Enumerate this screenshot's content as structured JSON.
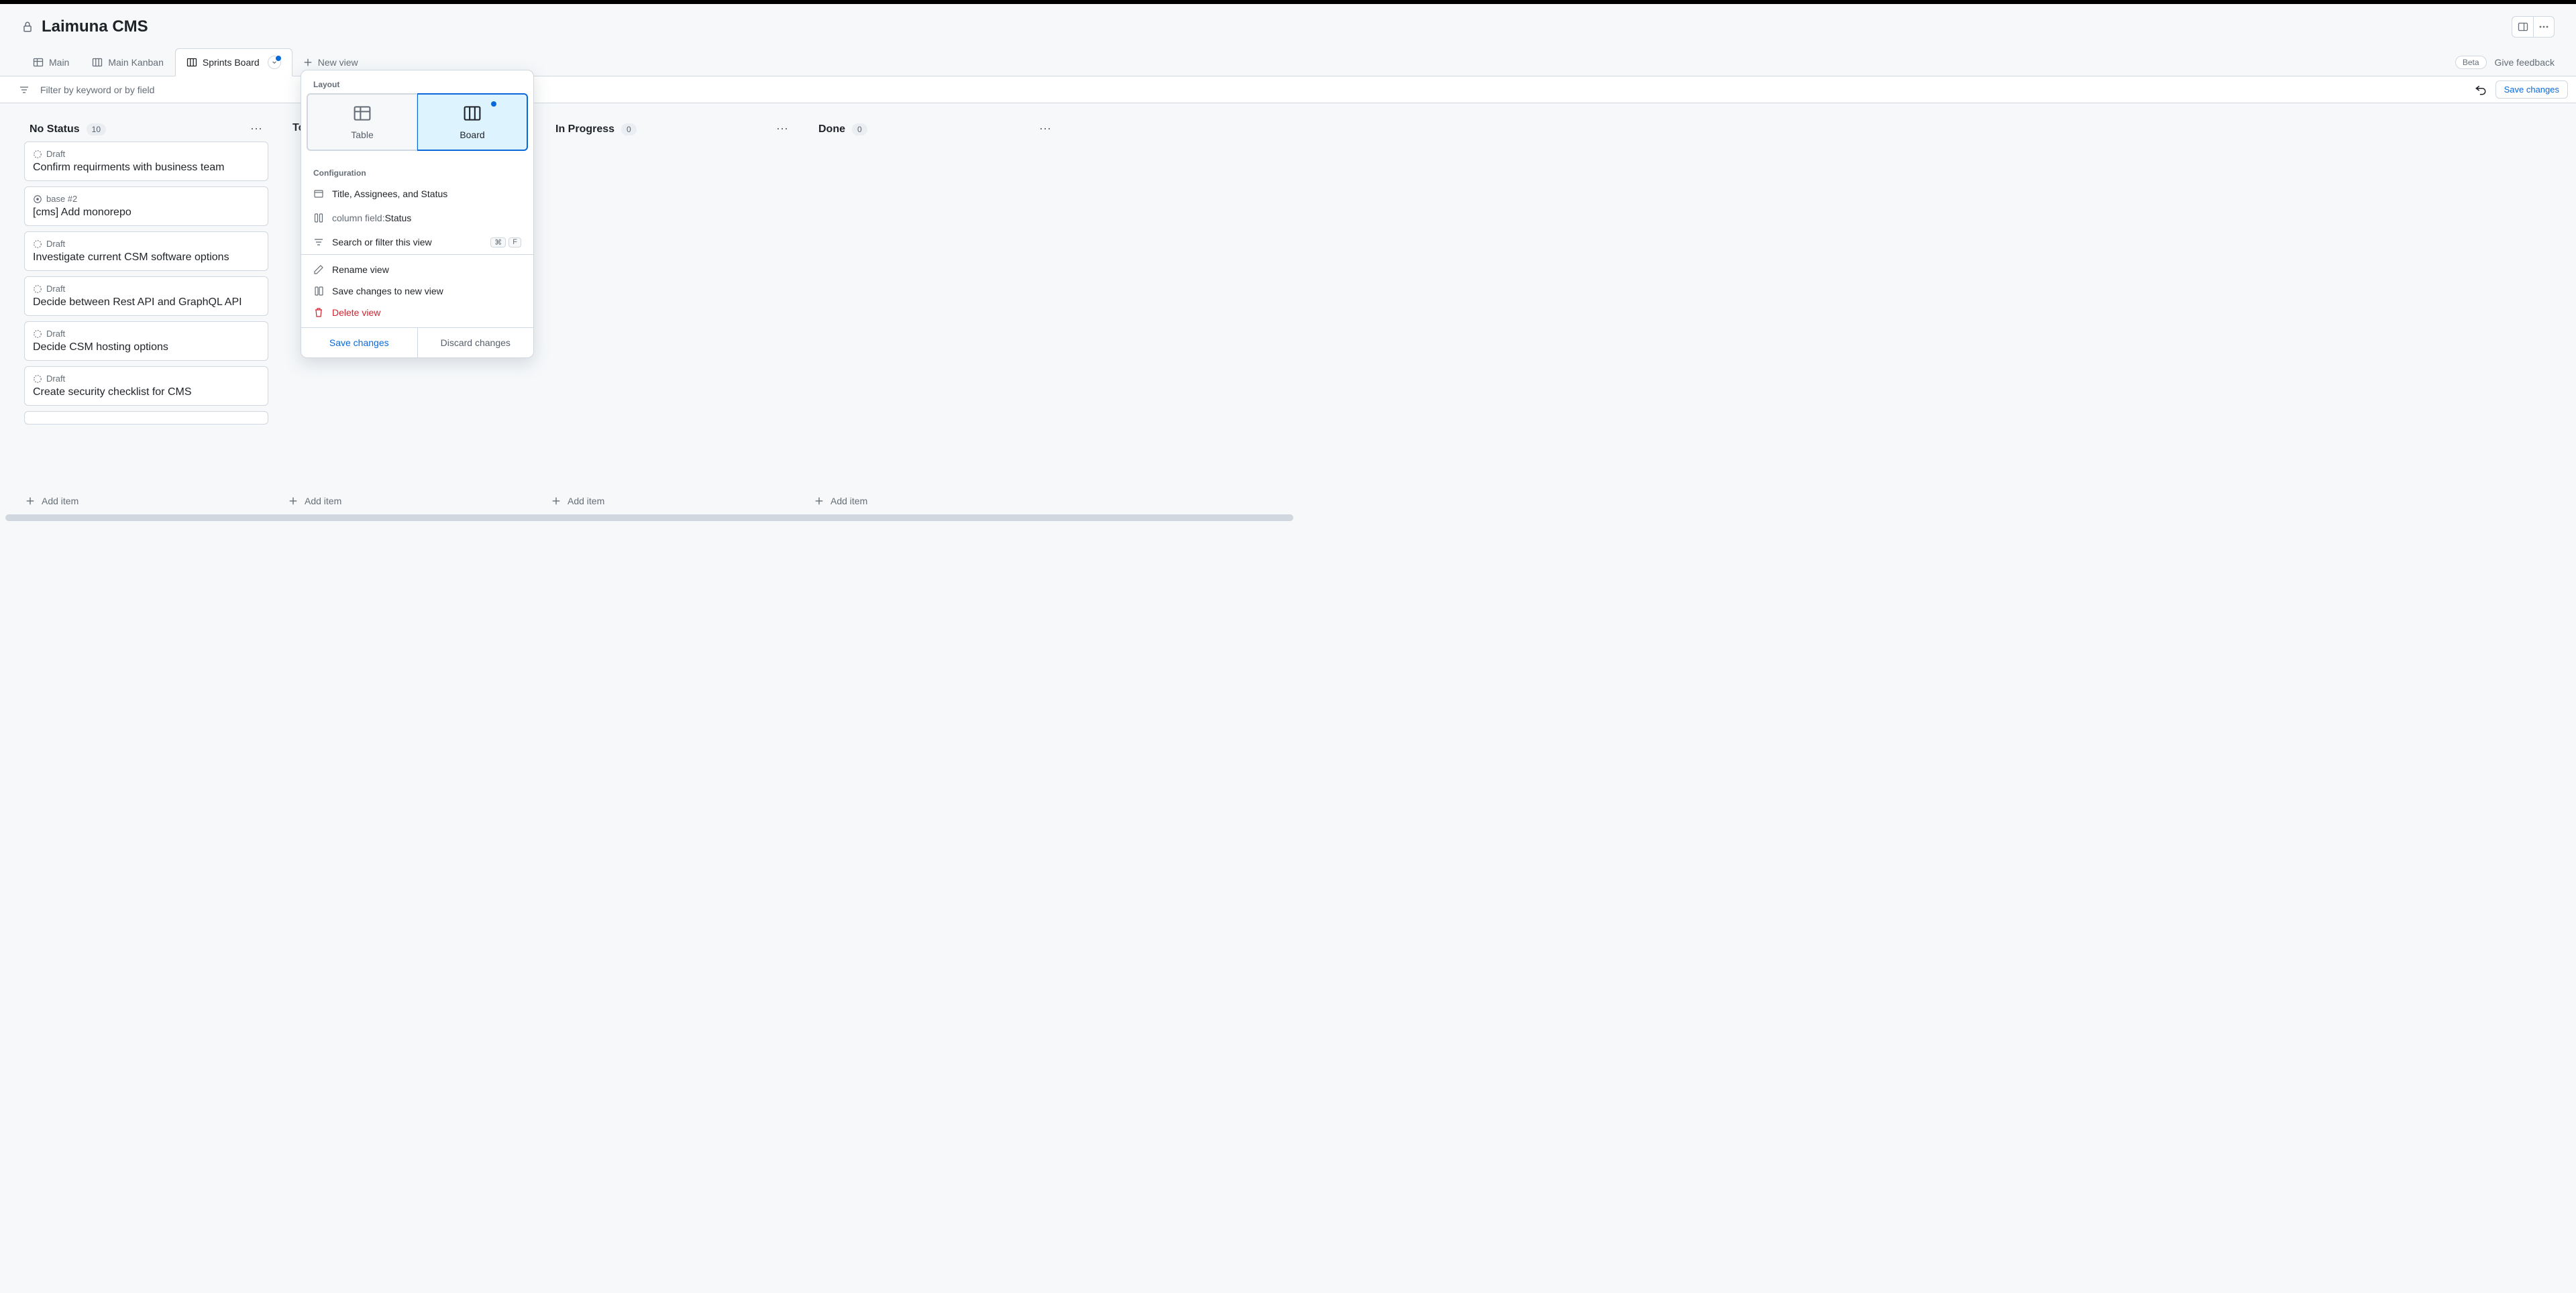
{
  "project": {
    "title": "Laimuna CMS"
  },
  "tabs": [
    {
      "label": "Main",
      "icon": "table"
    },
    {
      "label": "Main Kanban",
      "icon": "board"
    },
    {
      "label": "Sprints Board",
      "icon": "board",
      "active": true
    }
  ],
  "new_view_label": "New view",
  "beta_label": "Beta",
  "feedback_label": "Give feedback",
  "filter_placeholder": "Filter by keyword or by field",
  "save_changes_label": "Save changes",
  "columns": [
    {
      "title": "No Status",
      "count": "10",
      "cards": [
        {
          "status": "Draft",
          "icon": "draft",
          "title": "Confirm requirments with business team"
        },
        {
          "status": "base #2",
          "icon": "issue",
          "title": "[cms] Add monorepo"
        },
        {
          "status": "Draft",
          "icon": "draft",
          "title": "Investigate current CSM software options"
        },
        {
          "status": "Draft",
          "icon": "draft",
          "title": "Decide between Rest API and GraphQL API"
        },
        {
          "status": "Draft",
          "icon": "draft",
          "title": "Decide CSM hosting options"
        },
        {
          "status": "Draft",
          "icon": "draft",
          "title": "Create security checklist for CMS"
        }
      ],
      "add_label": "Add item"
    },
    {
      "title": "To",
      "count": "",
      "cards": [],
      "add_label": "Add item"
    },
    {
      "title": "In Progress",
      "count": "0",
      "cards": [],
      "add_label": "Add item"
    },
    {
      "title": "Done",
      "count": "0",
      "cards": [],
      "add_label": "Add item"
    }
  ],
  "popover": {
    "layout_label": "Layout",
    "layout_table": "Table",
    "layout_board": "Board",
    "config_label": "Configuration",
    "config_fields": "Title, Assignees, and Status",
    "config_columnfield_label": "column field:",
    "config_columnfield_value": "Status",
    "config_search": "Search or filter this view",
    "kbd_cmd": "⌘",
    "kbd_f": "F",
    "rename": "Rename view",
    "save_new": "Save changes to new view",
    "delete": "Delete view",
    "save": "Save changes",
    "discard": "Discard changes"
  }
}
